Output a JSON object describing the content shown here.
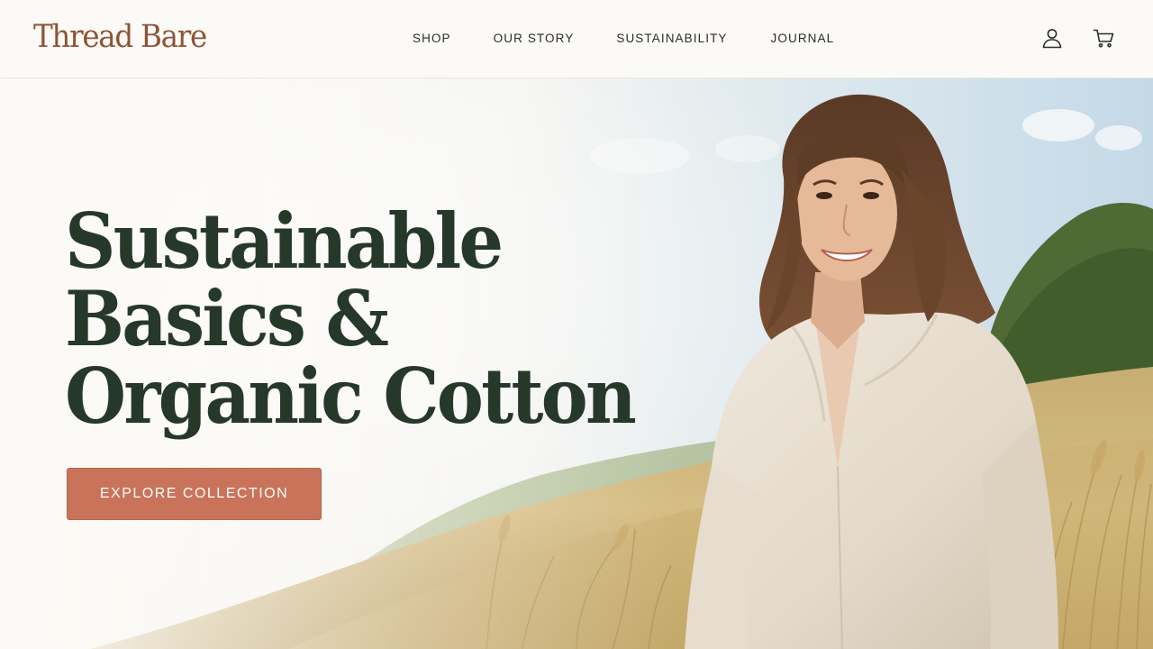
{
  "brand": {
    "logo_text": "Thread Bare",
    "color": "#8f5336"
  },
  "nav": {
    "items": [
      {
        "label": "SHOP"
      },
      {
        "label": "OUR STORY"
      },
      {
        "label": "SUSTAINABILITY"
      },
      {
        "label": "JOURNAL"
      }
    ]
  },
  "header_icons": {
    "account": "user-icon",
    "cart": "cart-icon"
  },
  "hero": {
    "headline": [
      "Sustainable",
      "Basics &",
      "Organic Cotton"
    ],
    "headline_color": "#26382a",
    "cta_label": "EXPLORE COLLECTION",
    "cta_color": "#c9735a",
    "image": "woman in linen shirt smiling in a golden grass field"
  }
}
